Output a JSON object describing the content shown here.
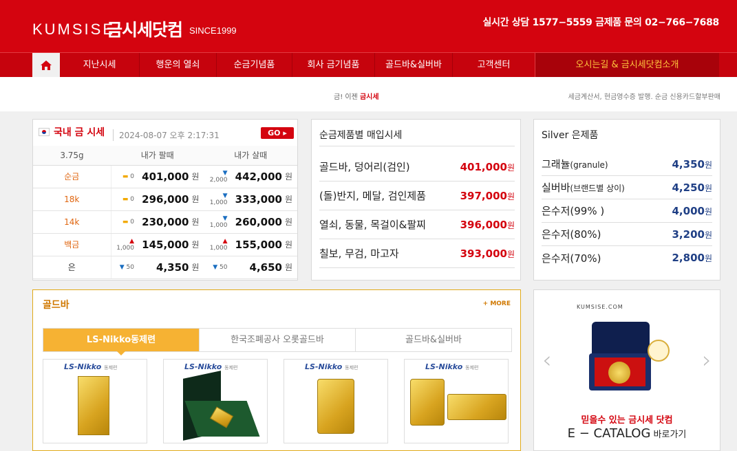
{
  "header": {
    "logo_en": "KUMSISE",
    "logo_kr": "금시세닷컴",
    "since": "SINCE1999",
    "contact": "실시간 상담 1577−5559  금제품 문의 02−766−7688"
  },
  "nav": {
    "items": [
      "지난시세",
      "행운의 열쇠",
      "순금기념품",
      "회사 금기념품",
      "골드바&실버바",
      "고객센터"
    ],
    "promo": "오시는길 & 금시세닷컴소개"
  },
  "subbar": {
    "center_prefix": "금! 이젠 ",
    "center_brand": "금시세",
    "right": "세금계산서, 현금영수증 발행. 순금 신용카드할부판매"
  },
  "gold_price": {
    "title": "국내 금 시세",
    "datetime": "2024-08-07 오후 2:17:31",
    "go_label": "GO ▸",
    "headers": [
      "3.75g",
      "내가 팔때",
      "내가 살때"
    ],
    "unit": "원",
    "rows": [
      {
        "name": "순금",
        "sell_chg": "0",
        "sell": "401,000",
        "buy_chg": "2,000",
        "buy": "442,000"
      },
      {
        "name": "18k",
        "sell_chg": "0",
        "sell": "296,000",
        "buy_chg": "1,000",
        "buy": "333,000"
      },
      {
        "name": "14k",
        "sell_chg": "0",
        "sell": "230,000",
        "buy_chg": "1,000",
        "buy": "260,000"
      },
      {
        "name": "백금",
        "sell_chg": "1,000",
        "sell": "145,000",
        "buy_chg": "1,000",
        "buy": "155,000"
      },
      {
        "name": "은",
        "sell_chg": "50",
        "sell": "4,350",
        "buy_chg": "50",
        "buy": "4,650"
      }
    ]
  },
  "buy_price": {
    "title": "순금제품별 매입시세",
    "unit": "원",
    "rows": [
      {
        "label": "골드바, 덩어리(검인)",
        "price": "401,000"
      },
      {
        "label": "(돌)반지, 메달, 검인제품",
        "price": "397,000"
      },
      {
        "label": "열쇠, 동물, 목걸이&팔찌",
        "price": "396,000"
      },
      {
        "label": "칠보, 무검, 마고자",
        "price": "393,000"
      }
    ]
  },
  "silver": {
    "title": "Silver 은제품",
    "unit": "원",
    "rows": [
      {
        "label": "그래뉼",
        "sub": "(granule)",
        "price": "4,350"
      },
      {
        "label": "실버바",
        "sub": "(브랜드별 상이)",
        "price": "4,250"
      },
      {
        "label": "은수저",
        "sub": "(99% )",
        "price": "4,000"
      },
      {
        "label": "은수저",
        "sub": "(80%)",
        "price": "3,200"
      },
      {
        "label": "은수저",
        "sub": "(70%)",
        "price": "2,800"
      }
    ]
  },
  "goldbar": {
    "title": "골드바",
    "more": "+ MORE",
    "tabs": [
      "LS-Nikko동제련",
      "한국조폐공사 오롯골드바",
      "골드바&실버바"
    ],
    "brand": "LS-Nikko",
    "brand_sub": "동제련"
  },
  "catalog": {
    "logo": "KUMSISE.COM",
    "line1": "믿을수 있는 금시세 닷컴",
    "line2_big": "E − CATALOG",
    "line2_small": " 바로가기"
  },
  "colors": {
    "brand_red": "#d4040f",
    "gold": "#f6b233",
    "silver_price": "#1f3f85"
  }
}
